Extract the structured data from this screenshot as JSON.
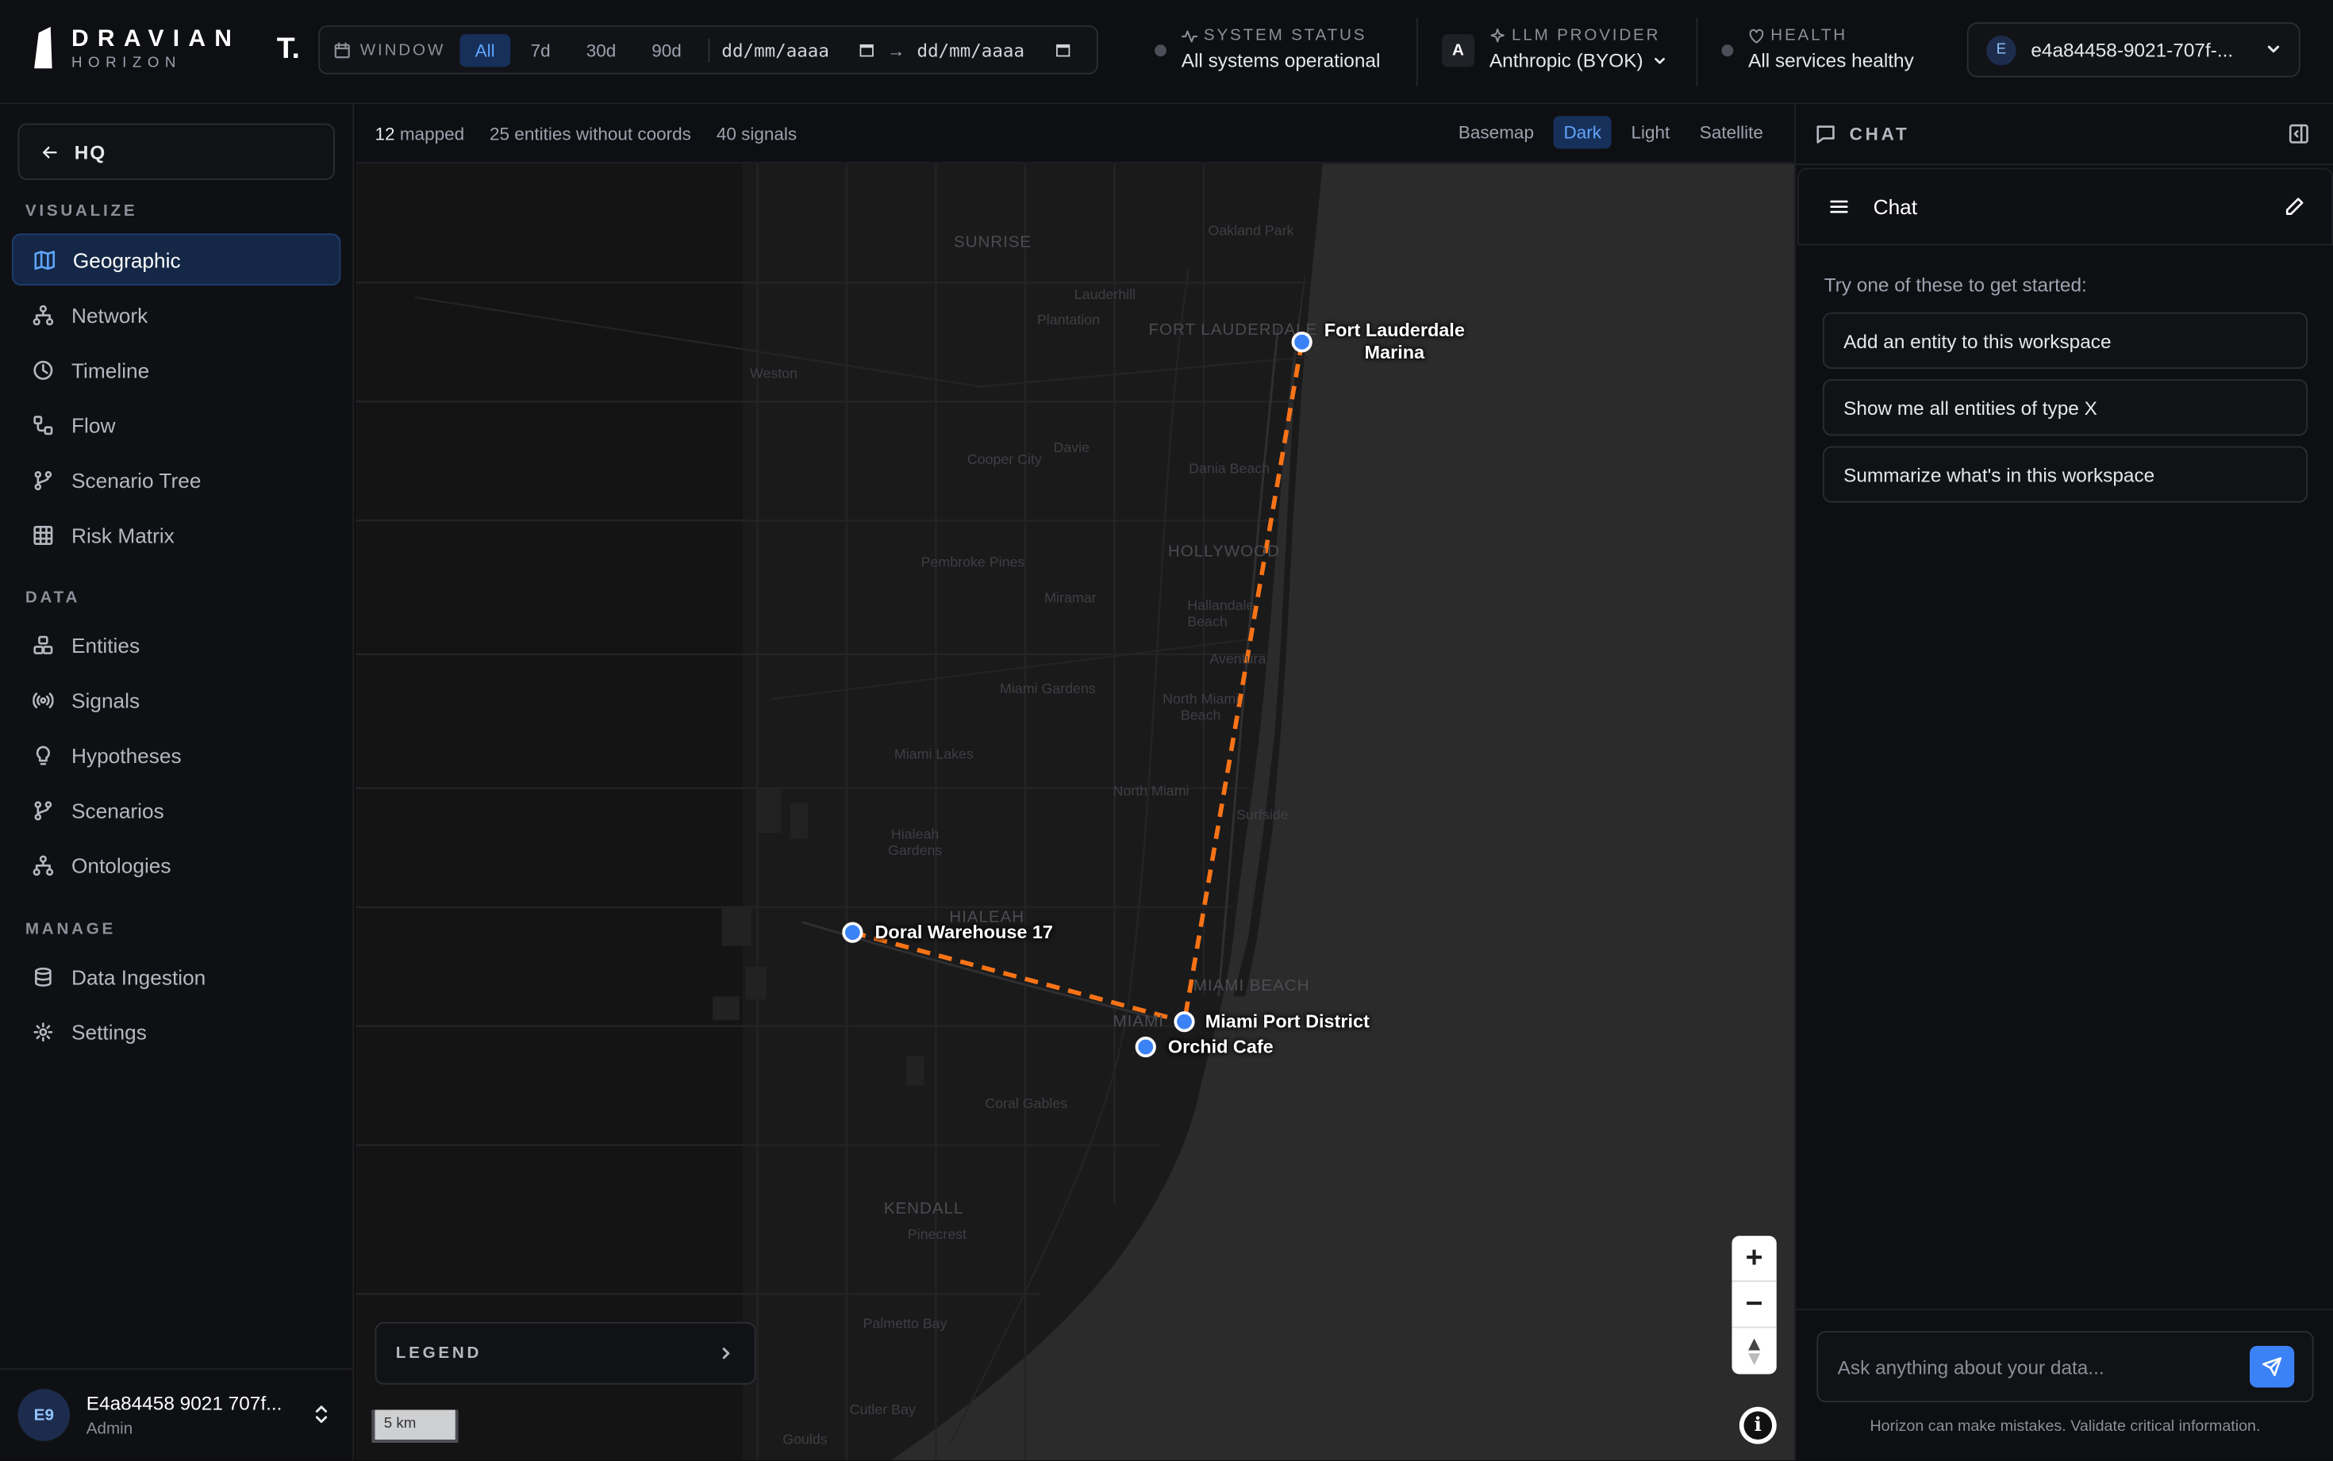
{
  "brand": {
    "name": "DRAVIAN",
    "sub": "HORIZON",
    "workspace_initial": "T."
  },
  "window": {
    "label": "WINDOW",
    "options": [
      "All",
      "7d",
      "30d",
      "90d"
    ],
    "selected": "All",
    "from_placeholder": "dd/mm/aaaa",
    "to_placeholder": "dd/mm/aaaa",
    "arrow": "→"
  },
  "system_status": {
    "label": "SYSTEM STATUS",
    "value": "All systems operational"
  },
  "llm_provider": {
    "badge": "A",
    "label": "LLM PROVIDER",
    "value": "Anthropic (BYOK)"
  },
  "health": {
    "label": "HEALTH",
    "value": "All services healthy"
  },
  "user_select": {
    "badge": "E",
    "value": "e4a84458-9021-707f-..."
  },
  "sidebar": {
    "back_label": "HQ",
    "sections": [
      {
        "label": "VISUALIZE",
        "items": [
          "Geographic",
          "Network",
          "Timeline",
          "Flow",
          "Scenario Tree",
          "Risk Matrix"
        ]
      },
      {
        "label": "DATA",
        "items": [
          "Entities",
          "Signals",
          "Hypotheses",
          "Scenarios",
          "Ontologies"
        ]
      },
      {
        "label": "MANAGE",
        "items": [
          "Data Ingestion",
          "Settings"
        ]
      }
    ],
    "active_item": "Geographic",
    "user": {
      "initials": "E9",
      "name": "E4a84458 9021 707f...",
      "role": "Admin"
    }
  },
  "map": {
    "stats": {
      "mapped_count": "12",
      "mapped_label": "mapped",
      "without_coords": "25 entities without coords",
      "signals": "40 signals"
    },
    "styles": [
      "Basemap",
      "Dark",
      "Light",
      "Satellite"
    ],
    "selected_style": "Dark",
    "markers": [
      {
        "name": "Fort Lauderdale Marina",
        "line1": "Fort Lauderdale",
        "line2": "Marina"
      },
      {
        "name": "Doral Warehouse 17"
      },
      {
        "name": "Miami Port District"
      },
      {
        "name": "Orchid Cafe"
      }
    ],
    "links": [
      {
        "from": "Fort Lauderdale Marina",
        "to": "Miami Port District"
      },
      {
        "from": "Doral Warehouse 17",
        "to": "Miami Port District"
      }
    ],
    "link_color": "#f97316",
    "marker_color": "#3b82f6",
    "places": [
      "SUNRISE",
      "Oakland Park",
      "Lauderhill",
      "Plantation",
      "FORT LAUDERDALE",
      "Weston",
      "Davie",
      "Cooper City",
      "Dania Beach",
      "HOLLYWOOD",
      "Pembroke Pines",
      "Miramar",
      "Hallandale Beach",
      "Aventura",
      "Miami Gardens",
      "North Miami Beach",
      "Miami Lakes",
      "North Miami",
      "Surfside",
      "Hialeah Gardens",
      "HIALEAH",
      "MIAMI BEACH",
      "MIAMI",
      "Coral Gables",
      "KENDALL",
      "Pinecrest",
      "Palmetto Bay",
      "Cutler Bay",
      "Goulds"
    ],
    "legend_label": "LEGEND",
    "scale_label": "5 km",
    "zoom_in": "+",
    "zoom_out": "−",
    "info": "i"
  },
  "chat": {
    "header": "CHAT",
    "title": "Chat",
    "prompt": "Try one of these to get started:",
    "suggestions": [
      "Add an entity to this workspace",
      "Show me all entities of type X",
      "Summarize what's in this workspace"
    ],
    "input_placeholder": "Ask anything about your data...",
    "disclaimer": "Horizon can make mistakes. Validate critical information."
  }
}
